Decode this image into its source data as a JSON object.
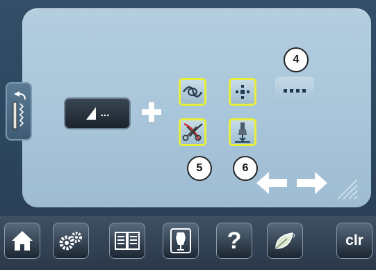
{
  "main": {
    "value_box": {
      "text": "..."
    },
    "badges": {
      "b4": "4",
      "b5": "5",
      "b6": "6"
    }
  },
  "toolbar": {
    "clr_label": "clr",
    "help_label": "?",
    "eco_label": "eco"
  },
  "icons": {
    "back": "back-stitch-icon",
    "plus": "plus-icon",
    "tie_off": "knot-icon",
    "cut": "scissors-icon",
    "center": "needle-position-icon",
    "foot": "presser-foot-icon",
    "dots": "dotted-line-icon",
    "left_arrow": "arrow-left-icon",
    "right_arrow": "arrow-right-icon",
    "home": "home-icon",
    "setup": "gear-icon",
    "tutorial": "book-icon",
    "guide": "dress-form-icon",
    "help": "question-icon",
    "eco": "eco-leaf-icon"
  },
  "colors": {
    "highlight": "#e8ee3a",
    "panel": "#a9c6da"
  }
}
